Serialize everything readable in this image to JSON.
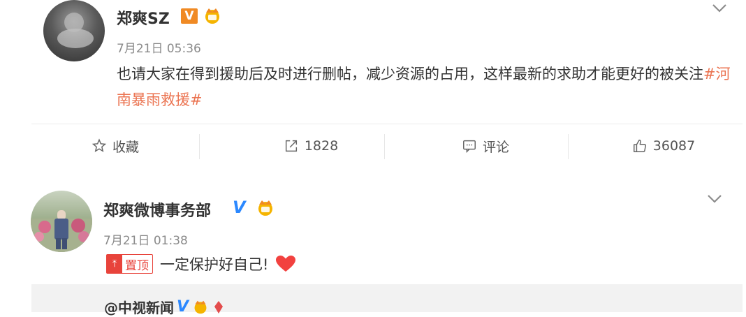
{
  "post1": {
    "author": "郑爽SZ",
    "time": "7月21日 05:36",
    "text": "也请大家在得到援助后及时进行删帖，减少资源的占用，这样最新的求助才能更好的被关注",
    "topic": "#河南暴雨救援#",
    "actions": {
      "favorite_label": "收藏",
      "repost_count": "1828",
      "comment_label": "评论",
      "like_count": "36087"
    }
  },
  "post2": {
    "author": "郑爽微博事务部",
    "time": "7月21日 01:38",
    "pin_label": "置顶",
    "text": "一定保护好自己!",
    "repost_author": "@中视新闻"
  },
  "colors": {
    "topic": "#eb7350",
    "verified_blue": "#2b88ff",
    "verified_orange": "#f08a24",
    "pin_red": "#e8433b",
    "heart": "#f2413f"
  }
}
